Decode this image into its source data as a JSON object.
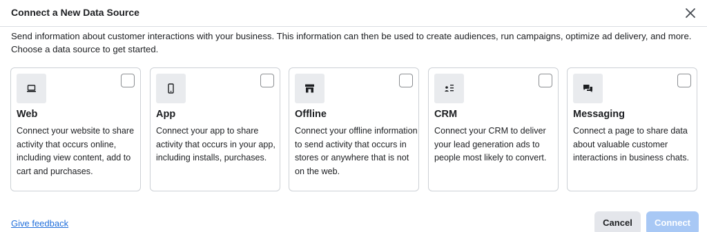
{
  "dialog": {
    "title": "Connect a New Data Source",
    "description": "Send information about customer interactions with your business. This information can then be used to create audiences, run campaigns, optimize ad delivery, and more. Choose a data source to get started."
  },
  "cards": [
    {
      "title": "Web",
      "description": "Connect your website to share activity that occurs online, including view content, add to cart and purchases.",
      "icon": "laptop-icon",
      "checked": false
    },
    {
      "title": "App",
      "description": "Connect your app to share activity that occurs in your app, including installs, purchases.",
      "icon": "mobile-phone-icon",
      "checked": false
    },
    {
      "title": "Offline",
      "description": "Connect your offline information to send activity that occurs in stores or anywhere that is not on the web.",
      "icon": "storefront-icon",
      "checked": false
    },
    {
      "title": "CRM",
      "description": "Connect your CRM to deliver your lead generation ads to people most likely to convert.",
      "icon": "people-list-icon",
      "checked": false
    },
    {
      "title": "Messaging",
      "description": "Connect a page to share data about valuable customer interactions in business chats.",
      "icon": "chat-bubbles-icon",
      "checked": false
    }
  ],
  "footer": {
    "feedback_label": "Give feedback",
    "cancel_label": "Cancel",
    "connect_label": "Connect"
  },
  "colors": {
    "link": "#216fdb",
    "connect_disabled": "#a8c8f5",
    "cancel_bg": "#e4e6eb",
    "card_border": "#ccd0d5"
  }
}
